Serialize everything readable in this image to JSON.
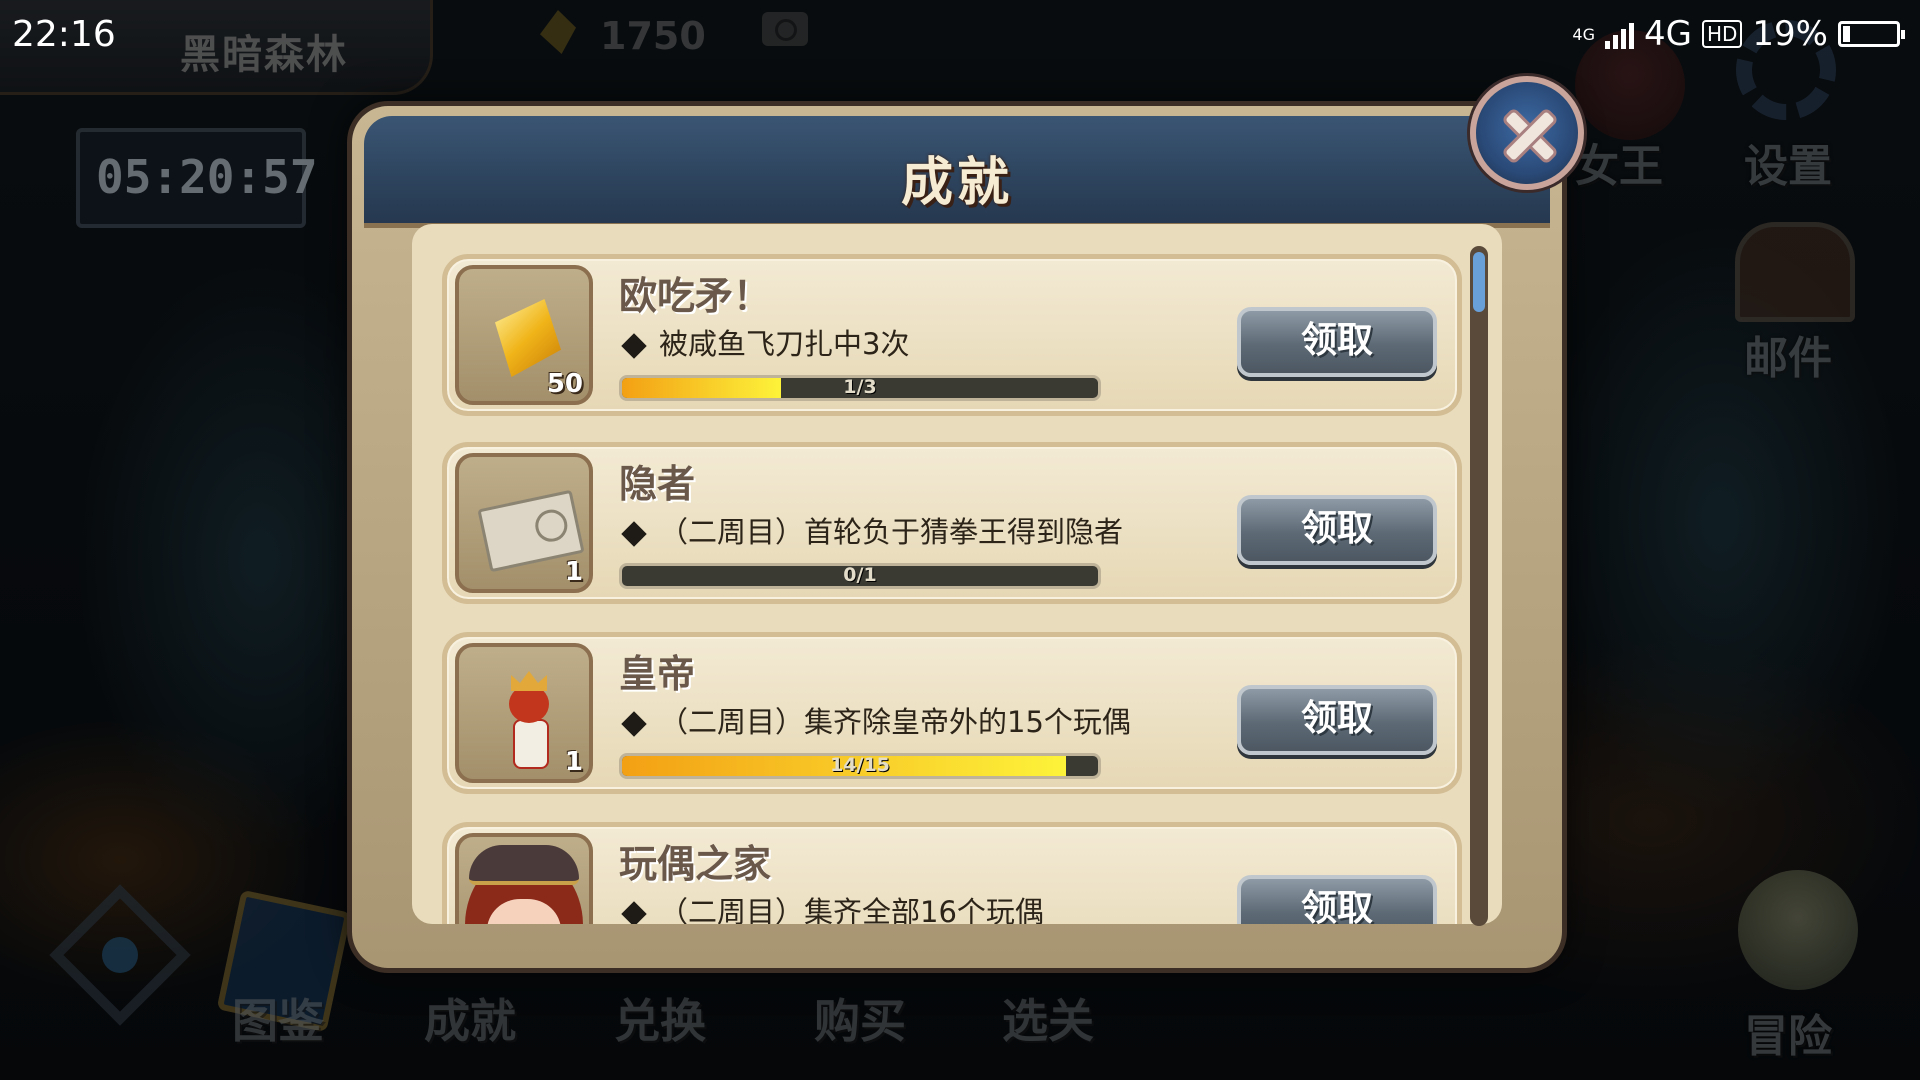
{
  "status_bar": {
    "time": "22:16",
    "network_small": "4G",
    "network": "4G",
    "hd_badge": "HD",
    "battery": "19%",
    "battery_level": 0.19
  },
  "hud": {
    "location": "黑暗森林",
    "timer": "05:20:57",
    "gem_count": "1750"
  },
  "side_menu": {
    "queen_label": "女王",
    "settings_label": "设置",
    "mail_label": "邮件",
    "adventure_label": "冒险"
  },
  "bottom_menu": {
    "items": [
      "图鉴",
      "成就",
      "兑换",
      "购买",
      "选关"
    ]
  },
  "modal": {
    "title": "成就",
    "achievements": [
      {
        "title": "欧吃矛！",
        "description": "被咸鱼飞刀扎中3次",
        "reward_icon": "crystal-icon",
        "reward_count": "50",
        "progress_text": "1/3",
        "progress": 0.333,
        "button": "领取"
      },
      {
        "title": "隐者",
        "description": "（二周目）首轮负于猜拳王得到隐者",
        "reward_icon": "ticket-icon",
        "reward_count": "1",
        "progress_text": "0/1",
        "progress": 0,
        "button": "领取"
      },
      {
        "title": "皇帝",
        "description": "（二周目）集齐除皇帝外的15个玩偶",
        "reward_icon": "emperor-doll-icon",
        "reward_count": "1",
        "progress_text": "14/15",
        "progress": 0.933,
        "button": "领取"
      },
      {
        "title": "玩偶之家",
        "description": "（二周目）集齐全部16个玩偶",
        "reward_icon": "dollhouse-avatar",
        "button": "领取"
      }
    ]
  },
  "colors": {
    "progress_start": "#f3a014",
    "progress_end": "#fdf33a",
    "header_blue": "#2f4763",
    "parchment": "#e9dcbd"
  }
}
